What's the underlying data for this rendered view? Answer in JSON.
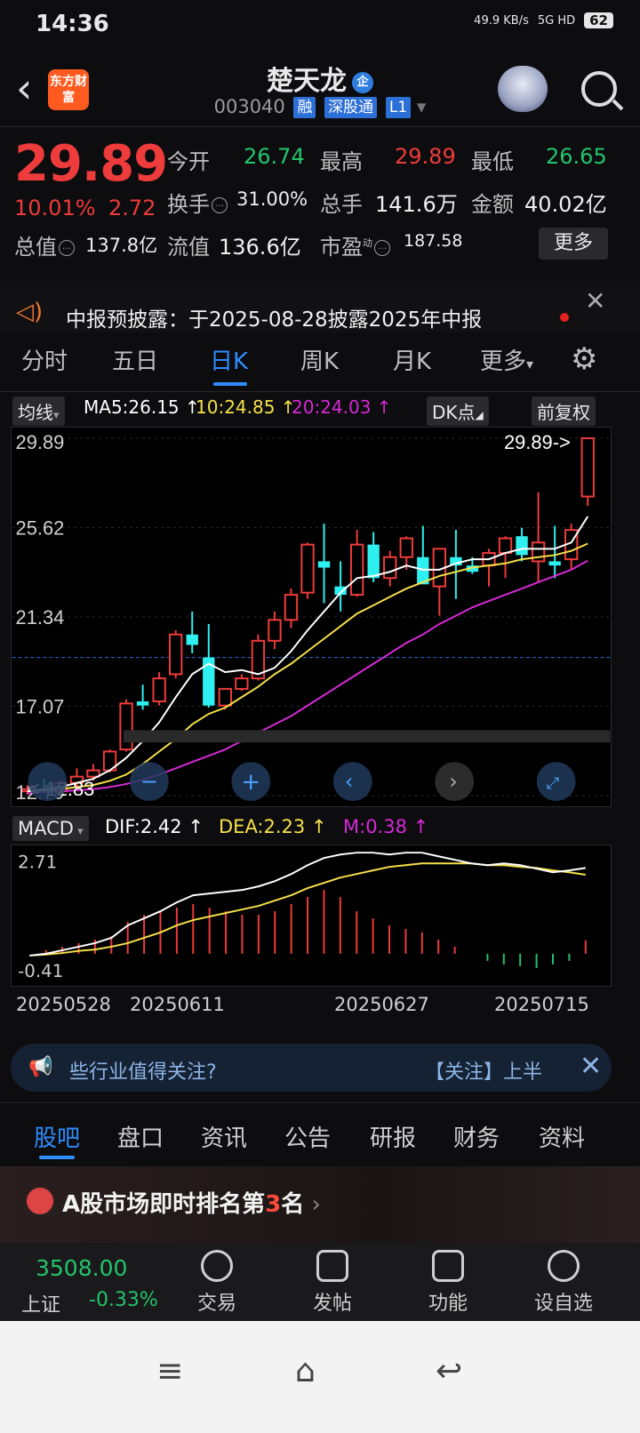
{
  "status": {
    "time": "14:36",
    "network": "49.9 KB/s",
    "signal": "5G HD",
    "battery": "62"
  },
  "header": {
    "title": "楚天龙",
    "title_badge": "企",
    "code": "003040",
    "tags": [
      "融",
      "深股通",
      "L1"
    ],
    "logo_text": "东方财富"
  },
  "quote": {
    "price": "29.89",
    "pct": "10.01%",
    "change": "2.72",
    "open_label": "今开",
    "open": "26.74",
    "high_label": "最高",
    "high": "29.89",
    "low_label": "最低",
    "low": "26.65",
    "turnover_label": "换手",
    "turnover": "31.00%",
    "volume_label": "总手",
    "volume": "141.6万",
    "amount_label": "金额",
    "amount": "40.02亿",
    "mktcap_label": "总值",
    "mktcap": "137.8亿",
    "float_label": "流值",
    "float": "136.6亿",
    "pe_label": "市盈",
    "pe_sup": "动",
    "pe": "187.58",
    "more": "更多"
  },
  "notice": {
    "text": "中报预披露：于2025-08-28披露2025年中报"
  },
  "period_tabs": [
    "分时",
    "五日",
    "日K",
    "周K",
    "月K",
    "更多"
  ],
  "ma": {
    "selector": "均线",
    "ma5": "MA5:26.15 ↑",
    "ma10": "10:24.85 ↑",
    "ma20": "20:24.03 ↑",
    "dk": "DK点",
    "adjust": "前复权"
  },
  "kchart": {
    "y_labels": [
      "29.89",
      "25.62",
      "21.34",
      "17.07",
      "12.79"
    ],
    "max_note": "29.89->",
    "min_note": "<-12.83"
  },
  "macd": {
    "selector": "MACD",
    "dif": "DIF:2.42 ↑",
    "dea": "DEA:2.23 ↑",
    "m": "M:0.38 ↑",
    "y_top": "2.71",
    "y_bottom": "-0.41"
  },
  "dates": [
    "20250528",
    "20250611",
    "20250627",
    "20250715"
  ],
  "banner": {
    "left": "些行业值得关注?",
    "right": "【关注】上半"
  },
  "bottom_tabs": [
    "股吧",
    "盘口",
    "资讯",
    "公告",
    "研报",
    "财务",
    "资料"
  ],
  "rank": {
    "prefix": "A股市场即时排名第",
    "num": "3",
    "suffix": "名"
  },
  "nav": {
    "index_value": "3508.00",
    "index_name": "上证",
    "index_pct": "-0.33%",
    "items": [
      "交易",
      "发帖",
      "功能",
      "设自选"
    ]
  },
  "colors": {
    "up": "#ee3b3b",
    "down": "#23c36a",
    "accent": "#2f8cff",
    "ma5": "#ffffff",
    "ma10": "#f5e04a",
    "ma20": "#d629d6",
    "candle_down": "#2ff0f0"
  },
  "chart_data": [
    {
      "type": "candlestick",
      "title": "",
      "ylim": [
        12.79,
        29.89
      ],
      "ohlc": [
        [
          13.0,
          13.3,
          12.83,
          13.1
        ],
        [
          13.1,
          13.6,
          12.9,
          13.0
        ],
        [
          13.0,
          13.5,
          12.9,
          13.4
        ],
        [
          13.4,
          14.1,
          13.2,
          13.7
        ],
        [
          13.7,
          14.3,
          13.5,
          14.0
        ],
        [
          14.0,
          15.0,
          13.9,
          14.9
        ],
        [
          15.0,
          17.4,
          14.9,
          17.2
        ],
        [
          17.3,
          18.1,
          16.9,
          17.1
        ],
        [
          17.3,
          18.7,
          17.1,
          18.4
        ],
        [
          18.6,
          20.7,
          18.4,
          20.5
        ],
        [
          20.5,
          21.6,
          19.6,
          20.0
        ],
        [
          19.4,
          21.0,
          17.0,
          17.1
        ],
        [
          17.1,
          17.9,
          16.9,
          17.9
        ],
        [
          17.9,
          18.6,
          17.8,
          18.4
        ],
        [
          18.4,
          20.5,
          18.3,
          20.2
        ],
        [
          20.2,
          21.6,
          19.8,
          21.2
        ],
        [
          21.2,
          22.7,
          20.8,
          22.4
        ],
        [
          22.5,
          24.9,
          22.2,
          24.8
        ],
        [
          24.0,
          25.8,
          22.0,
          23.7
        ],
        [
          22.8,
          24.0,
          21.6,
          22.4
        ],
        [
          22.4,
          25.5,
          22.3,
          24.8
        ],
        [
          24.8,
          25.4,
          23.0,
          23.2
        ],
        [
          23.2,
          24.5,
          22.8,
          24.2
        ],
        [
          24.2,
          25.2,
          23.6,
          25.1
        ],
        [
          24.2,
          25.7,
          24.0,
          22.9
        ],
        [
          22.8,
          24.5,
          21.4,
          24.6
        ],
        [
          24.2,
          25.5,
          22.2,
          23.8
        ],
        [
          23.8,
          24.2,
          23.4,
          23.5
        ],
        [
          23.8,
          24.6,
          22.8,
          24.4
        ],
        [
          24.4,
          25.2,
          23.2,
          25.1
        ],
        [
          25.2,
          25.6,
          24.0,
          24.3
        ],
        [
          24.0,
          27.3,
          23.0,
          24.9
        ],
        [
          24.0,
          25.7,
          23.2,
          23.8
        ],
        [
          24.1,
          25.8,
          23.6,
          25.5
        ],
        [
          27.1,
          29.89,
          26.65,
          29.89
        ]
      ],
      "ma5": [
        13.0,
        13.1,
        13.2,
        13.4,
        13.6,
        14.0,
        14.6,
        15.4,
        16.3,
        17.5,
        18.6,
        19.1,
        18.7,
        18.8,
        18.6,
        18.9,
        19.7,
        20.7,
        21.6,
        22.5,
        23.2,
        23.3,
        23.5,
        23.8,
        23.6,
        23.6,
        23.9,
        24.1,
        24.1,
        24.4,
        24.6,
        24.6,
        24.6,
        24.9,
        26.15
      ],
      "ma10": [
        13.0,
        13.05,
        13.1,
        13.2,
        13.3,
        13.5,
        13.8,
        14.3,
        14.9,
        15.5,
        16.2,
        16.7,
        17.0,
        17.5,
        18.0,
        18.6,
        19.1,
        19.7,
        20.3,
        20.9,
        21.5,
        21.9,
        22.3,
        22.7,
        23.0,
        23.3,
        23.5,
        23.7,
        23.8,
        23.9,
        24.1,
        24.2,
        24.3,
        24.5,
        24.85
      ],
      "ma20": [
        12.9,
        12.95,
        13.0,
        13.05,
        13.1,
        13.2,
        13.35,
        13.55,
        13.8,
        14.1,
        14.4,
        14.7,
        15.0,
        15.4,
        15.8,
        16.2,
        16.6,
        17.1,
        17.6,
        18.1,
        18.6,
        19.1,
        19.6,
        20.1,
        20.5,
        21.0,
        21.4,
        21.8,
        22.1,
        22.4,
        22.7,
        23.0,
        23.3,
        23.6,
        24.03
      ]
    },
    {
      "type": "bar",
      "title": "MACD",
      "ylim": [
        -0.41,
        2.71
      ],
      "dif": [
        -0.05,
        0.0,
        0.1,
        0.2,
        0.3,
        0.45,
        0.8,
        1.0,
        1.2,
        1.45,
        1.65,
        1.7,
        1.75,
        1.8,
        1.9,
        2.05,
        2.25,
        2.5,
        2.7,
        2.8,
        2.85,
        2.85,
        2.8,
        2.85,
        2.85,
        2.75,
        2.65,
        2.55,
        2.5,
        2.55,
        2.5,
        2.4,
        2.3,
        2.35,
        2.42
      ],
      "dea": [
        -0.05,
        -0.02,
        0.02,
        0.08,
        0.12,
        0.2,
        0.3,
        0.45,
        0.6,
        0.8,
        0.95,
        1.05,
        1.15,
        1.25,
        1.35,
        1.5,
        1.65,
        1.85,
        2.0,
        2.15,
        2.25,
        2.35,
        2.45,
        2.5,
        2.55,
        2.55,
        2.55,
        2.55,
        2.5,
        2.5,
        2.45,
        2.42,
        2.35,
        2.3,
        2.23
      ],
      "m": [
        0.0,
        0.1,
        0.2,
        0.3,
        0.4,
        0.5,
        0.9,
        1.1,
        1.2,
        1.3,
        1.4,
        1.3,
        1.2,
        1.1,
        1.1,
        1.2,
        1.4,
        1.6,
        1.8,
        1.6,
        1.2,
        1.0,
        0.8,
        0.7,
        0.6,
        0.4,
        0.2,
        0.0,
        -0.2,
        -0.3,
        -0.35,
        -0.4,
        -0.3,
        -0.2,
        0.38
      ]
    }
  ]
}
